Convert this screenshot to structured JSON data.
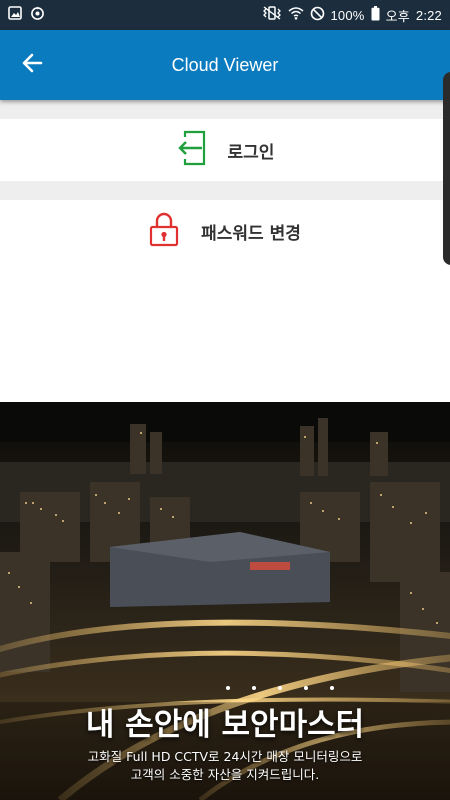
{
  "status_bar": {
    "battery": "100%",
    "ampm": "오후",
    "time": "2:22",
    "left_icons": [
      "gallery-icon",
      "sync-icon"
    ],
    "right_icons": [
      "vibrate-icon",
      "wifi-icon",
      "blocked-icon",
      "battery-icon"
    ]
  },
  "app_bar": {
    "title": "Cloud Viewer",
    "back_icon": "arrow-left-icon",
    "color": "#0a7bbf"
  },
  "menu": {
    "items": [
      {
        "label": "로그인",
        "icon": "login-icon",
        "icon_color": "#1fa03c"
      },
      {
        "label": "패스워드 변경",
        "icon": "lock-icon",
        "icon_color": "#e03030"
      }
    ]
  },
  "banner": {
    "title": "내 손안에 보안마스터",
    "subtitle_line1": "고화질 Full HD CCTV로 24시간 매장 모니터링으로",
    "subtitle_line2": "고객의 소중한 자산을 지켜드립니다.",
    "pager_dots": 5
  }
}
